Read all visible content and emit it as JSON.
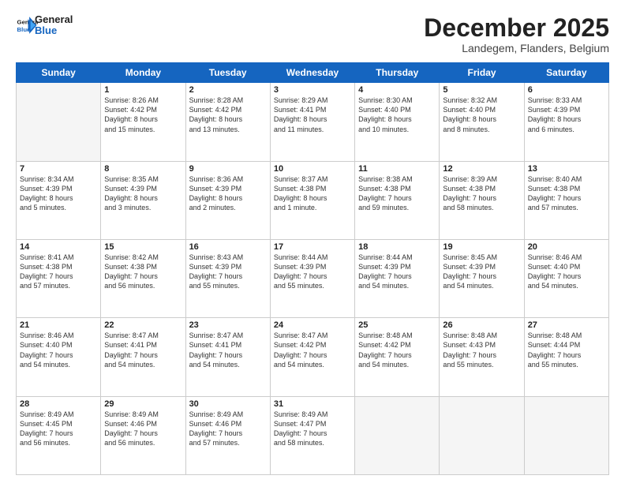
{
  "header": {
    "logo_line1": "General",
    "logo_line2": "Blue",
    "month": "December 2025",
    "location": "Landegem, Flanders, Belgium"
  },
  "days_of_week": [
    "Sunday",
    "Monday",
    "Tuesday",
    "Wednesday",
    "Thursday",
    "Friday",
    "Saturday"
  ],
  "weeks": [
    [
      {
        "day": "",
        "info": ""
      },
      {
        "day": "1",
        "info": "Sunrise: 8:26 AM\nSunset: 4:42 PM\nDaylight: 8 hours\nand 15 minutes."
      },
      {
        "day": "2",
        "info": "Sunrise: 8:28 AM\nSunset: 4:42 PM\nDaylight: 8 hours\nand 13 minutes."
      },
      {
        "day": "3",
        "info": "Sunrise: 8:29 AM\nSunset: 4:41 PM\nDaylight: 8 hours\nand 11 minutes."
      },
      {
        "day": "4",
        "info": "Sunrise: 8:30 AM\nSunset: 4:40 PM\nDaylight: 8 hours\nand 10 minutes."
      },
      {
        "day": "5",
        "info": "Sunrise: 8:32 AM\nSunset: 4:40 PM\nDaylight: 8 hours\nand 8 minutes."
      },
      {
        "day": "6",
        "info": "Sunrise: 8:33 AM\nSunset: 4:39 PM\nDaylight: 8 hours\nand 6 minutes."
      }
    ],
    [
      {
        "day": "7",
        "info": "Sunrise: 8:34 AM\nSunset: 4:39 PM\nDaylight: 8 hours\nand 5 minutes."
      },
      {
        "day": "8",
        "info": "Sunrise: 8:35 AM\nSunset: 4:39 PM\nDaylight: 8 hours\nand 3 minutes."
      },
      {
        "day": "9",
        "info": "Sunrise: 8:36 AM\nSunset: 4:39 PM\nDaylight: 8 hours\nand 2 minutes."
      },
      {
        "day": "10",
        "info": "Sunrise: 8:37 AM\nSunset: 4:38 PM\nDaylight: 8 hours\nand 1 minute."
      },
      {
        "day": "11",
        "info": "Sunrise: 8:38 AM\nSunset: 4:38 PM\nDaylight: 7 hours\nand 59 minutes."
      },
      {
        "day": "12",
        "info": "Sunrise: 8:39 AM\nSunset: 4:38 PM\nDaylight: 7 hours\nand 58 minutes."
      },
      {
        "day": "13",
        "info": "Sunrise: 8:40 AM\nSunset: 4:38 PM\nDaylight: 7 hours\nand 57 minutes."
      }
    ],
    [
      {
        "day": "14",
        "info": "Sunrise: 8:41 AM\nSunset: 4:38 PM\nDaylight: 7 hours\nand 57 minutes."
      },
      {
        "day": "15",
        "info": "Sunrise: 8:42 AM\nSunset: 4:38 PM\nDaylight: 7 hours\nand 56 minutes."
      },
      {
        "day": "16",
        "info": "Sunrise: 8:43 AM\nSunset: 4:39 PM\nDaylight: 7 hours\nand 55 minutes."
      },
      {
        "day": "17",
        "info": "Sunrise: 8:44 AM\nSunset: 4:39 PM\nDaylight: 7 hours\nand 55 minutes."
      },
      {
        "day": "18",
        "info": "Sunrise: 8:44 AM\nSunset: 4:39 PM\nDaylight: 7 hours\nand 54 minutes."
      },
      {
        "day": "19",
        "info": "Sunrise: 8:45 AM\nSunset: 4:39 PM\nDaylight: 7 hours\nand 54 minutes."
      },
      {
        "day": "20",
        "info": "Sunrise: 8:46 AM\nSunset: 4:40 PM\nDaylight: 7 hours\nand 54 minutes."
      }
    ],
    [
      {
        "day": "21",
        "info": "Sunrise: 8:46 AM\nSunset: 4:40 PM\nDaylight: 7 hours\nand 54 minutes."
      },
      {
        "day": "22",
        "info": "Sunrise: 8:47 AM\nSunset: 4:41 PM\nDaylight: 7 hours\nand 54 minutes."
      },
      {
        "day": "23",
        "info": "Sunrise: 8:47 AM\nSunset: 4:41 PM\nDaylight: 7 hours\nand 54 minutes."
      },
      {
        "day": "24",
        "info": "Sunrise: 8:47 AM\nSunset: 4:42 PM\nDaylight: 7 hours\nand 54 minutes."
      },
      {
        "day": "25",
        "info": "Sunrise: 8:48 AM\nSunset: 4:42 PM\nDaylight: 7 hours\nand 54 minutes."
      },
      {
        "day": "26",
        "info": "Sunrise: 8:48 AM\nSunset: 4:43 PM\nDaylight: 7 hours\nand 55 minutes."
      },
      {
        "day": "27",
        "info": "Sunrise: 8:48 AM\nSunset: 4:44 PM\nDaylight: 7 hours\nand 55 minutes."
      }
    ],
    [
      {
        "day": "28",
        "info": "Sunrise: 8:49 AM\nSunset: 4:45 PM\nDaylight: 7 hours\nand 56 minutes."
      },
      {
        "day": "29",
        "info": "Sunrise: 8:49 AM\nSunset: 4:46 PM\nDaylight: 7 hours\nand 56 minutes."
      },
      {
        "day": "30",
        "info": "Sunrise: 8:49 AM\nSunset: 4:46 PM\nDaylight: 7 hours\nand 57 minutes."
      },
      {
        "day": "31",
        "info": "Sunrise: 8:49 AM\nSunset: 4:47 PM\nDaylight: 7 hours\nand 58 minutes."
      },
      {
        "day": "",
        "info": ""
      },
      {
        "day": "",
        "info": ""
      },
      {
        "day": "",
        "info": ""
      }
    ]
  ]
}
